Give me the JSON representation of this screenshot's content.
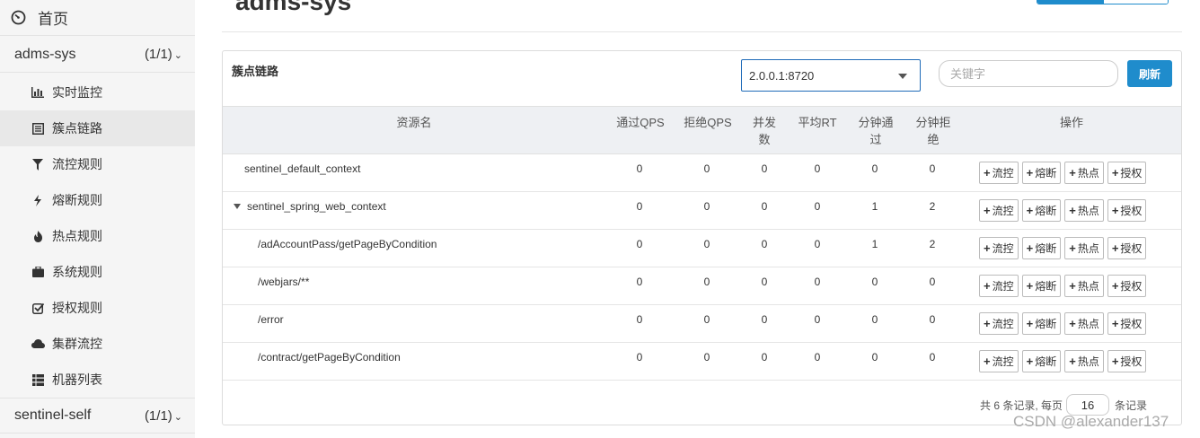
{
  "sidebar": {
    "home": "首页",
    "apps": [
      {
        "name": "adms-sys",
        "count": "(1/1)"
      },
      {
        "name": "sentinel-self",
        "count": "(1/1)"
      }
    ],
    "items": [
      {
        "label": "实时监控",
        "icon": "bar-chart-icon"
      },
      {
        "label": "簇点链路",
        "icon": "list-icon"
      },
      {
        "label": "流控规则",
        "icon": "filter-icon"
      },
      {
        "label": "熔断规则",
        "icon": "flash-icon"
      },
      {
        "label": "热点规则",
        "icon": "fire-icon"
      },
      {
        "label": "系统规则",
        "icon": "briefcase-icon"
      },
      {
        "label": "授权规则",
        "icon": "check-icon"
      },
      {
        "label": "集群流控",
        "icon": "cloud-icon"
      },
      {
        "label": "机器列表",
        "icon": "th-list-icon"
      }
    ]
  },
  "page": {
    "title": "adms-sys"
  },
  "panel": {
    "title": "簇点链路",
    "machine": "2.0.0.1:8720",
    "search_placeholder": "关键字",
    "refresh": "刷新"
  },
  "table": {
    "headers": {
      "resource": "资源名",
      "pass_qps": "通过QPS",
      "block_qps": "拒绝QPS",
      "concurrency_1": "并发",
      "concurrency_2": "数",
      "avg_rt": "平均RT",
      "min_pass_1": "分钟通",
      "min_pass_2": "过",
      "min_block_1": "分钟拒",
      "min_block_2": "绝",
      "ops": "操作"
    },
    "rows": [
      {
        "name": "sentinel_default_context",
        "pass": "0",
        "block": "0",
        "conc": "0",
        "rt": "0",
        "mpass": "0",
        "mblock": "0"
      },
      {
        "name": "sentinel_spring_web_context",
        "pass": "0",
        "block": "0",
        "conc": "0",
        "rt": "0",
        "mpass": "1",
        "mblock": "2"
      },
      {
        "name": "/adAccountPass/getPageByCondition",
        "pass": "0",
        "block": "0",
        "conc": "0",
        "rt": "0",
        "mpass": "1",
        "mblock": "2"
      },
      {
        "name": "/webjars/**",
        "pass": "0",
        "block": "0",
        "conc": "0",
        "rt": "0",
        "mpass": "0",
        "mblock": "0"
      },
      {
        "name": "/error",
        "pass": "0",
        "block": "0",
        "conc": "0",
        "rt": "0",
        "mpass": "0",
        "mblock": "0"
      },
      {
        "name": "/contract/getPageByCondition",
        "pass": "0",
        "block": "0",
        "conc": "0",
        "rt": "0",
        "mpass": "0",
        "mblock": "0"
      }
    ],
    "op_labels": [
      "流控",
      "熔断",
      "热点",
      "授权"
    ]
  },
  "pager": {
    "prefix": "共 6 条记录, 每页",
    "size": "16",
    "suffix": "条记录"
  },
  "watermark": "CSDN @alexander137",
  "colors": {
    "primary": "#1f8ccc",
    "select_border": "#1f6bb8",
    "header_bg": "#eef0f3",
    "sidebar_bg": "#f5f5f5"
  }
}
